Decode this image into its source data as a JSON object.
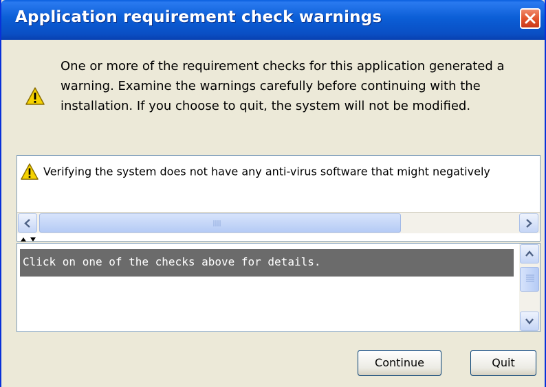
{
  "window": {
    "title": "Application requirement check warnings"
  },
  "message": {
    "icon": "warning-icon",
    "text": "One or more of the requirement checks for this application generated a warning. Examine the warnings carefully before continuing with the installation. If you choose to quit, the system will not be modified."
  },
  "checks": {
    "items": [
      {
        "icon": "warning-icon",
        "label": "Verifying the system does not have any anti-virus software that might negatively"
      }
    ]
  },
  "details": {
    "text": "Click on one of the checks above for details."
  },
  "buttons": {
    "continue_label": "Continue",
    "quit_label": "Quit"
  },
  "colors": {
    "titlebar": "#0a5fde",
    "close_button": "#e2552e",
    "window_bg": "#ece9d8",
    "details_bar": "#6b6b6b",
    "warning_yellow": "#f5d200"
  }
}
